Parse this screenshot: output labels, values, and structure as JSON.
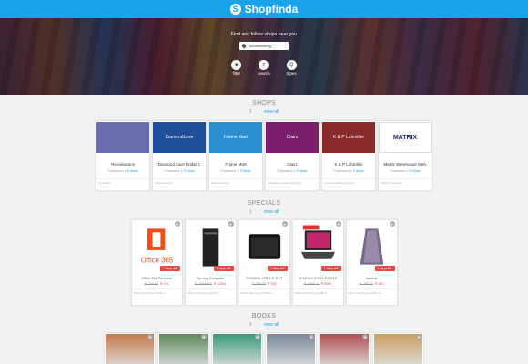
{
  "header": {
    "logo_text": "Shopfinda",
    "logo_mark": "S"
  },
  "hero": {
    "tagline": "Find and follow shops near you",
    "location_value": "Johannesburg",
    "actions": [
      {
        "label": "filter",
        "icon": "filter-icon",
        "glyph": "▼"
      },
      {
        "label": "search",
        "icon": "search-icon",
        "glyph": "⌕"
      },
      {
        "label": "types",
        "icon": "tag-icon",
        "glyph": "⚲"
      }
    ]
  },
  "shops": {
    "title": "SHOPS",
    "count": "6",
    "view_all": "view all",
    "items": [
      {
        "name": "Reminiscens",
        "followers_label": "Followers",
        "followers": "2",
        "follow": "Follow",
        "desc": "Fit attend",
        "img_text": "",
        "bg": "#6a6fb0"
      },
      {
        "name": "Diamond Love Bridal C",
        "followers_label": "Followers",
        "followers": "1",
        "follow": "Follow",
        "desc": "Welcome road",
        "img_text": "DiamondLove",
        "bg": "#1d4f9a"
      },
      {
        "name": "Frame Mart",
        "followers_label": "Followers",
        "followers": "0",
        "follow": "Follow",
        "desc": "Welcome road",
        "img_text": "Frame Mart",
        "bg": "#2a8fd0"
      },
      {
        "name": "Clairz",
        "followers_label": "Followers",
        "followers": "2",
        "follow": "Follow",
        "desc": "Fastpaste square Shopping",
        "img_text": "Clairz",
        "bg": "#7a1f6b"
      },
      {
        "name": "K & P Lohmiller",
        "followers_label": "Followers",
        "followers": "1",
        "follow": "Follow",
        "desc": "Foresta Shopping centre",
        "img_text": "K & P Lohmiller",
        "bg": "#8a2a2a"
      },
      {
        "name": "Matrix Warehouse Melv",
        "followers_label": "Followers",
        "followers": "5",
        "follow": "Follow",
        "desc": "Malvern shopping",
        "img_text": "MATRIX",
        "bg": "#ffffff"
      }
    ]
  },
  "specials": {
    "title": "SPECIALS",
    "count": "5",
    "view_all": "view all",
    "items": [
      {
        "name": "Office 365 Personal",
        "old_price": "R. 749.00",
        "new_price": "R 700",
        "badge": "7 days left",
        "desc": "Matrix warehouse melville st",
        "img": "office"
      },
      {
        "name": "Top dog Computer",
        "old_price": "R. 10999.00",
        "new_price": "R 10300",
        "badge": "7 days left",
        "desc": "Matrix warehouse melville st",
        "img": "pc"
      },
      {
        "name": "TOSHIBA 1TB 2.5\" EXT",
        "old_price": "R. 899.00",
        "new_price": "R 799",
        "badge": "7 days left",
        "desc": "Matrix warehouse melville st",
        "img": "hdd"
      },
      {
        "name": "LENOVO INTEL CS S10",
        "old_price": "R. 6999.00",
        "new_price": "R 6999",
        "badge": "7 days left",
        "desc": "Matrix warehouse melville st",
        "img": "laptop"
      },
      {
        "name": "Jackets",
        "old_price": "R. 390.00",
        "new_price": "R 320",
        "badge": "2 days left",
        "desc": "Matrix warehouse melville st",
        "img": "jacket"
      }
    ]
  },
  "books": {
    "title": "BOOKS",
    "count": "6",
    "view_all": "view all",
    "items": [
      {
        "bg": "#c47a4a"
      },
      {
        "bg": "#5a8a5a"
      },
      {
        "bg": "#3a9a7a"
      },
      {
        "bg": "#7a8a9a"
      },
      {
        "bg": "#b05050"
      },
      {
        "bg": "#c9a060"
      }
    ]
  }
}
